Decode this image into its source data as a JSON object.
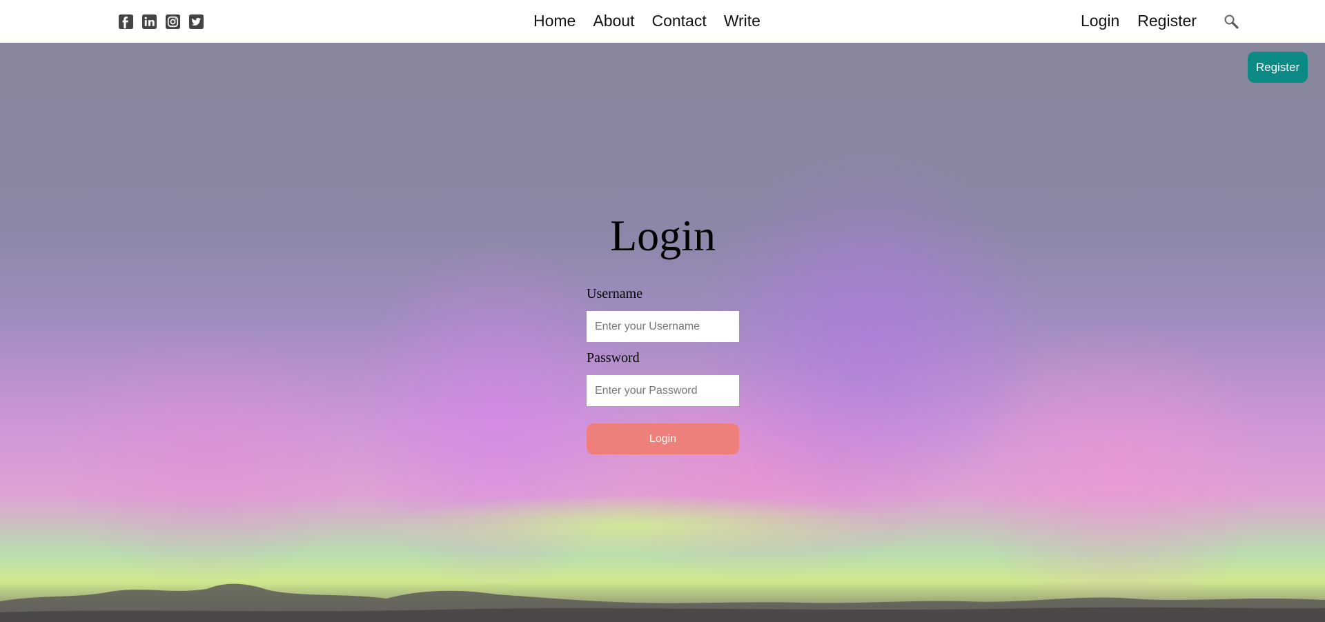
{
  "nav": {
    "social": [
      {
        "icon": "facebook-square-icon"
      },
      {
        "icon": "linkedin-square-icon"
      },
      {
        "icon": "instagram-square-icon"
      },
      {
        "icon": "twitter-square-icon"
      }
    ],
    "center_links": [
      "Home",
      "About",
      "Contact",
      "Write"
    ],
    "right_links": [
      "Login",
      "Register"
    ],
    "search_icon": "search-icon"
  },
  "register_button": "Register",
  "login": {
    "title": "Login",
    "username_label": "Username",
    "username_placeholder": "Enter your Username",
    "password_label": "Password",
    "password_placeholder": "Enter your Password",
    "submit_label": "Login"
  },
  "colors": {
    "register_button": "#0c8a86",
    "login_button": "#ef7f7a",
    "icon": "#444444"
  }
}
